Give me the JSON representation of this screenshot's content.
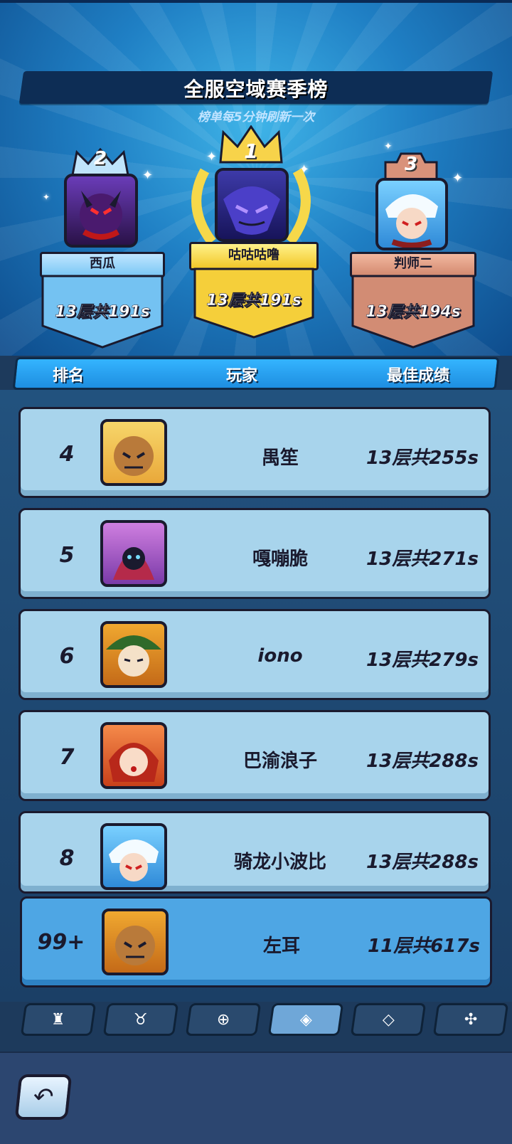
{
  "header": {
    "title": "全服空域赛季榜",
    "subtitle": "榜单每5分钟刷新一次"
  },
  "podium": [
    {
      "rank": "2",
      "name": "西瓜",
      "score": "13层共191s",
      "color": "#7cc8f5"
    },
    {
      "rank": "1",
      "name": "咕咕咕噜",
      "score": "13层共191s",
      "color": "#f7d34a"
    },
    {
      "rank": "3",
      "name": "判师二",
      "score": "13层共194s",
      "color": "#d9927a"
    }
  ],
  "columns": {
    "rank": "排名",
    "player": "玩家",
    "best": "最佳成绩"
  },
  "rows": [
    {
      "rank": "4",
      "name": "禺笙",
      "score": "13层共255s"
    },
    {
      "rank": "5",
      "name": "嘎嘣脆",
      "score": "13层共271s"
    },
    {
      "rank": "6",
      "name": "iono",
      "score": "13层共279s"
    },
    {
      "rank": "7",
      "name": "巴渝浪子",
      "score": "13层共288s"
    },
    {
      "rank": "8",
      "name": "骑龙小波比",
      "score": "13层共288s"
    }
  ],
  "me": {
    "rank": "99+",
    "name": "左耳",
    "score": "11层共617s"
  },
  "tabs": [
    {
      "icon": "castle-icon"
    },
    {
      "icon": "bull-icon"
    },
    {
      "icon": "shield-target-icon"
    },
    {
      "icon": "cards-icon",
      "active": true
    },
    {
      "icon": "diamond-badge-icon"
    },
    {
      "icon": "network-icon"
    }
  ]
}
